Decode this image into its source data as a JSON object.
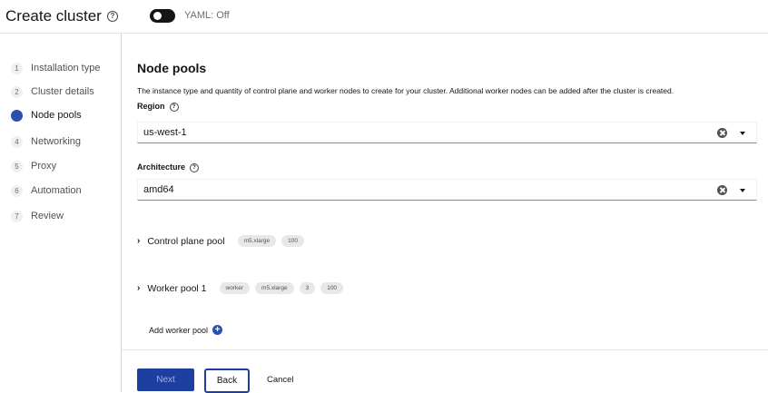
{
  "header": {
    "title": "Create cluster",
    "help_icon": "question-circle-icon",
    "yaml_toggle_label": "YAML: Off",
    "yaml_toggle_on": false
  },
  "wizard_nav": {
    "steps": [
      {
        "number": "1",
        "label": "Installation type",
        "active": false
      },
      {
        "number": "2",
        "label": "Cluster details",
        "active": false
      },
      {
        "number": "3",
        "label": "Node pools",
        "active": true
      },
      {
        "number": "4",
        "label": "Networking",
        "active": false
      },
      {
        "number": "5",
        "label": "Proxy",
        "active": false
      },
      {
        "number": "6",
        "label": "Automation",
        "active": false
      },
      {
        "number": "7",
        "label": "Review",
        "active": false
      }
    ]
  },
  "main": {
    "heading": "Node pools",
    "description": "The instance type and quantity of control plane and worker nodes to create for your cluster. Additional worker nodes can be added after the cluster is created.",
    "region": {
      "label": "Region",
      "value": "us-west-1"
    },
    "architecture": {
      "label": "Architecture",
      "value": "amd64"
    },
    "control_plane_pool": {
      "name": "Control plane pool",
      "chips": [
        "m5.xlarge",
        "100"
      ]
    },
    "worker_pool": {
      "name": "Worker pool 1",
      "chips": [
        "worker",
        "m5.xlarge",
        "3",
        "100"
      ]
    },
    "add_worker_pool_label": "Add worker pool"
  },
  "footer": {
    "next_label": "Next",
    "back_label": "Back",
    "cancel_label": "Cancel"
  },
  "colors": {
    "primary": "#1c3fa0",
    "active_step": "#2b4fb0",
    "chip_bg": "#e8e8e8"
  }
}
